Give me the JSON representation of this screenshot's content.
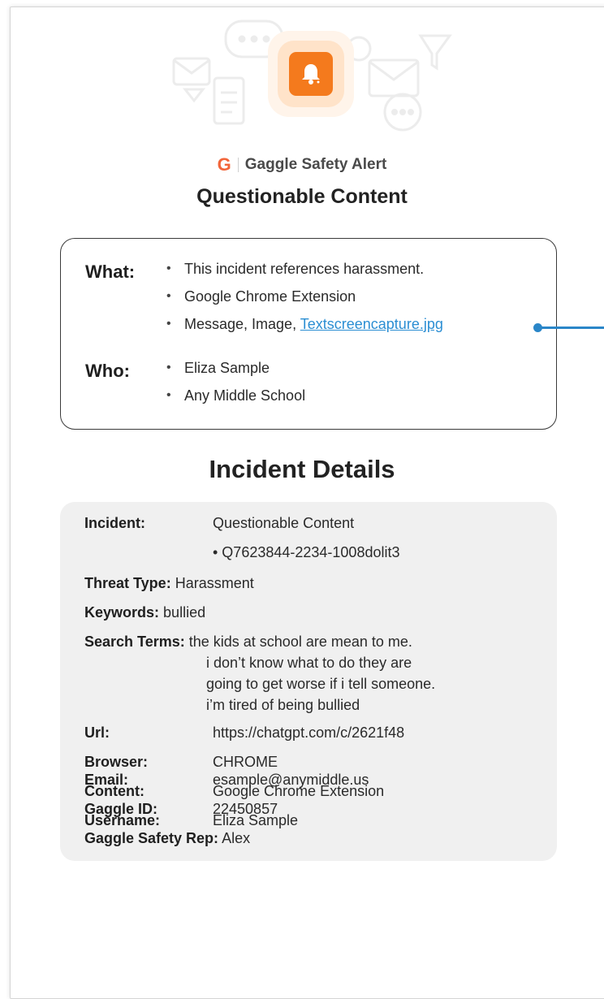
{
  "brand": {
    "logo_letter": "G",
    "name": "Gaggle Safety Alert",
    "accent": "#f47a1d"
  },
  "alert": {
    "title": "Questionable Content",
    "icon": "bell-icon"
  },
  "summary": {
    "what_label": "What:",
    "what_items": [
      "This incident references harassment.",
      "Google Chrome Extension"
    ],
    "what_attachment_prefix": "Message, Image, ",
    "what_attachment_link": "Textscreencapture.jpg",
    "who_label": "Who:",
    "who_items": [
      "Eliza Sample",
      "Any Middle School"
    ],
    "bullet": "•"
  },
  "details": {
    "section_title": "Incident Details",
    "incident_label": "Incident:",
    "incident_value": "Questionable Content",
    "incident_id": "• Q7623844-2234-1008dolit3",
    "threat_label": "Threat Type:",
    "threat_value": "Harassment",
    "keywords_label": "Keywords:",
    "keywords_value": "bullied",
    "search_label": "Search Terms:",
    "search_lines": [
      "the kids at school are mean to me.",
      "i don’t know what to do they are",
      "going to get worse if i tell someone.",
      "i’m tired of being bullied"
    ],
    "url_label": "Url:",
    "url_value": "https://chatgpt.com/c/2621f48",
    "browser_label": "Browser:",
    "browser_value": "CHROME",
    "content_label": "Content:",
    "content_value": "Google Chrome Extension",
    "username_label": "Username:",
    "username_value": "Eliza Sample",
    "email_label": "Email:",
    "email_value": "esample@anymiddle.us",
    "gaggle_id_label": "Gaggle ID:",
    "gaggle_id_value": "22450857",
    "rep_label": "Gaggle Safety Rep:",
    "rep_value": "Alex"
  },
  "colors": {
    "link": "#2b8ed3",
    "connector": "#2a86c8",
    "details_bg": "#f0f0f0"
  }
}
